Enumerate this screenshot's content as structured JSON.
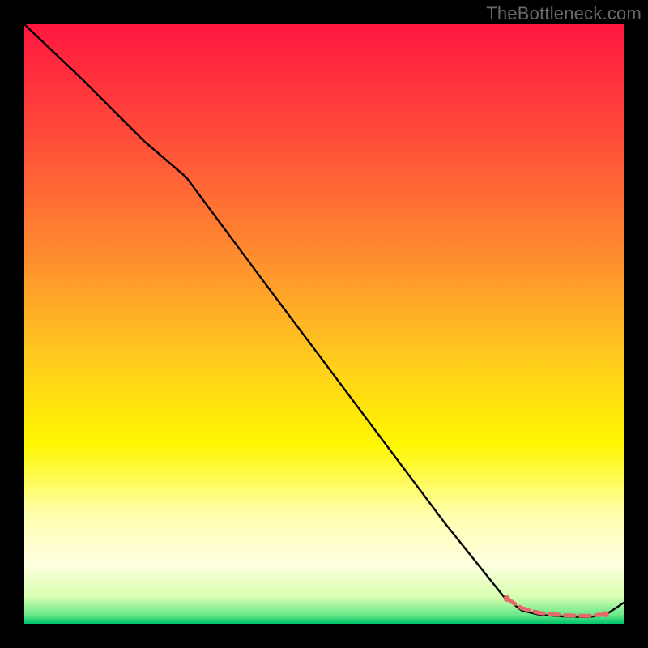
{
  "watermark": "TheBottleneck.com",
  "chart_data": {
    "type": "line",
    "title": "",
    "xlabel": "",
    "ylabel": "",
    "xlim": [
      0,
      100
    ],
    "ylim": [
      0,
      100
    ],
    "grid": false,
    "legend": "none",
    "gradient_stops": [
      {
        "offset": 0.0,
        "color": "#ff163f"
      },
      {
        "offset": 0.18,
        "color": "#ff4a3a"
      },
      {
        "offset": 0.38,
        "color": "#ff8a2f"
      },
      {
        "offset": 0.55,
        "color": "#ffc81f"
      },
      {
        "offset": 0.7,
        "color": "#fff700"
      },
      {
        "offset": 0.82,
        "color": "#ffffb0"
      },
      {
        "offset": 0.9,
        "color": "#ffffe0"
      },
      {
        "offset": 0.955,
        "color": "#d8ffb0"
      },
      {
        "offset": 0.985,
        "color": "#6be88a"
      },
      {
        "offset": 1.0,
        "color": "#00c46a"
      }
    ],
    "series": [
      {
        "name": "curve",
        "color": "#000000",
        "x": [
          0,
          10,
          20,
          27,
          40,
          55,
          70,
          80,
          83,
          86,
          90,
          94,
          97,
          100
        ],
        "y": [
          100,
          90.5,
          80.5,
          74.5,
          57,
          37,
          17,
          4.5,
          2.2,
          1.5,
          1.2,
          1.1,
          1.5,
          3.5
        ]
      }
    ],
    "markers": [
      {
        "name": "dash-start",
        "x": 80.5,
        "y": 4.2,
        "color": "#e66a6a",
        "r": 4
      },
      {
        "name": "dash-end",
        "x": 97.0,
        "y": 1.6,
        "color": "#e66a6a",
        "r": 4
      }
    ],
    "dash_segment": {
      "color": "#e66a6a",
      "width": 5,
      "x": [
        80.5,
        83,
        86,
        90,
        94,
        97
      ],
      "y": [
        4.2,
        2.6,
        1.8,
        1.4,
        1.3,
        1.6
      ]
    }
  }
}
